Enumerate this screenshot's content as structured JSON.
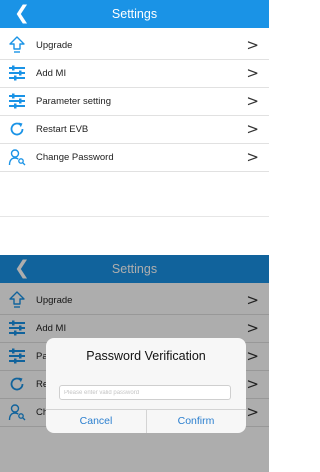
{
  "settings_screen": {
    "title": "Settings",
    "back_symbol": "❮",
    "items": [
      {
        "label": "Upgrade",
        "icon": "upgrade-arrow-icon"
      },
      {
        "label": "Add MI",
        "icon": "sliders-icon"
      },
      {
        "label": "Parameter setting",
        "icon": "sliders-icon"
      },
      {
        "label": "Restart EVB",
        "icon": "restart-icon"
      },
      {
        "label": "Change Password",
        "icon": "user-key-icon"
      }
    ],
    "chevron": ">"
  },
  "dialog": {
    "title": "Password Verification",
    "placeholder": "Please enter valid password",
    "cancel_label": "Cancel",
    "confirm_label": "Confirm"
  },
  "colors": {
    "navbar": "#1a93e6",
    "icon": "#1a93e6",
    "dialog_button": "#2b7fcf"
  }
}
